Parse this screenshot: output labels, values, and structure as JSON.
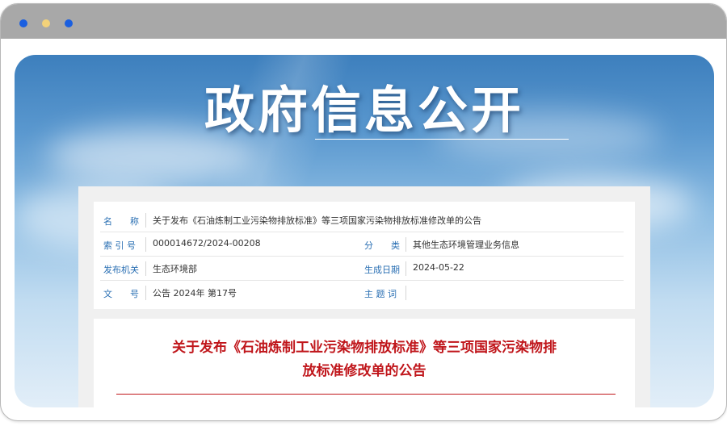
{
  "window": {
    "dots": [
      {
        "name": "dot-blue-1",
        "color": "#1a5fe0"
      },
      {
        "name": "dot-yellow",
        "color": "#f3d27a"
      },
      {
        "name": "dot-blue-2",
        "color": "#1a5fe0"
      }
    ]
  },
  "hero": {
    "title": "政府信息公开"
  },
  "meta": {
    "name_label": "名　　称",
    "name_value": "关于发布《石油炼制工业污染物排放标准》等三项国家污染物排放标准修改单的公告",
    "index_label": "索 引 号",
    "index_value": "000014672/2024-00208",
    "category_label": "分　　类",
    "category_value": "其他生态环境管理业务信息",
    "issuer_label": "发布机关",
    "issuer_value": "生态环境部",
    "date_label": "生成日期",
    "date_value": "2024-05-22",
    "docno_label": "文　　号",
    "docno_value": "公告 2024年 第17号",
    "keywords_label": "主 题 词",
    "keywords_value": ""
  },
  "doc": {
    "title_line1": "关于发布《石油炼制工业污染物排放标准》等三项国家污染物排",
    "title_line2": "放标准修改单的公告"
  },
  "colors": {
    "label_blue": "#2a6fb3",
    "title_red": "#c0161b"
  }
}
